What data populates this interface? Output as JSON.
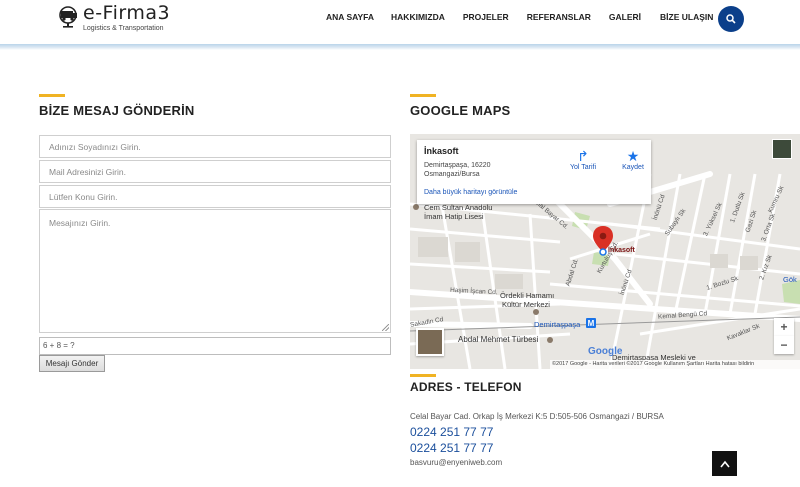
{
  "header": {
    "logo_name": "e-Firma3",
    "logo_tagline": "Logistics & Transportation",
    "nav": [
      {
        "label": "ANA SAYFA"
      },
      {
        "label": "HAKKIMIZDA"
      },
      {
        "label": "PROJELER"
      },
      {
        "label": "REFERANSLAR"
      },
      {
        "label": "GALERİ"
      },
      {
        "label": "BİZE ULAŞIN"
      }
    ],
    "search_icon": "search-icon",
    "accent_color": "#0b3f8a"
  },
  "contact_form": {
    "title": "BİZE MESAJ GÖNDERİN",
    "name_placeholder": "Adınızı Soyadınızı Girin.",
    "email_placeholder": "Mail Adresinizi Girin.",
    "subject_placeholder": "Lütfen Konu Girin.",
    "message_placeholder": "Mesajınızı Girin.",
    "captcha_text": "6 + 8 = ?",
    "submit_label": "Mesajı Gönder"
  },
  "map": {
    "title": "GOOGLE MAPS",
    "place_name": "İnkasoft",
    "place_address_1": "Demirtaşpaşa, 16220",
    "place_address_2": "Osmangazi/Bursa",
    "directions_label": "Yol Tarifi",
    "save_label": "Kaydet",
    "larger_map_link": "Daha büyük haritayı görüntüle",
    "pin_label": "İnkasoft",
    "labels": {
      "cem_sultan_1": "Cem Sultan Anadolu",
      "cem_sultan_2": "İmam Hatip Lisesi",
      "ordekli_1": "Ördekli Hamamı",
      "ordekli_2": "Kültür Merkezi",
      "demirtaspasa": "Demirtaşpaşa",
      "abdal_turbesi": "Abdal Mehmet Türbesi",
      "meslek": "Demirtaşpaşa Mesleki ve",
      "gok": "Gök"
    },
    "streets": {
      "celal_bayar": "Celal Bayar Cd.",
      "hasim_iscan": "Haşim İşcan Cd.",
      "kemal_bengu": "Kemal Bengü Cd",
      "abdal_cd": "Abdal Cd.",
      "inonu_cd": "İnönü Cd",
      "inonu_cd2": "İnönü Cd",
      "kurtulus": "Kurtuluş Cd.",
      "kaplica": "Kaplıca Sk",
      "bahar": "Bahar Sk",
      "subayli": "Subaylı Sk",
      "yuksel": "3. Yüksel Sk",
      "dutlu": "1. Dutlu Sk",
      "bozlu": "1. Bozlu Sk",
      "kiz": "2. Kız Sk",
      "orta": "3. Orta Sk",
      "akbiyik": "Akbıyık Sk",
      "kumru": "Kumru Sk",
      "gazi": "Gazi Sk",
      "ortabayir": "Ortabayır Sk",
      "kavaklar": "Kavaklar Sk",
      "sakadin": "Sakadin Cd"
    },
    "google_logo": "Google",
    "attribution": "©2017 Google - Harita verileri ©2017 Google    Kullanım Şartları    Harita hatası bildirin",
    "zoom_in": "+",
    "zoom_out": "−"
  },
  "address": {
    "title": "ADRES - TELEFON",
    "address_text": "Celal Bayar Cad. Orkap İş Merkezi K:5 D:505-506 Osmangazi / BURSA",
    "phone_1": "0224 251 77 77",
    "phone_2": "0224 251 77 77",
    "email": "basvuru@enyeniweb.com"
  },
  "colors": {
    "section_accent": "#f0b323",
    "phone_blue": "#1b4f9c"
  }
}
